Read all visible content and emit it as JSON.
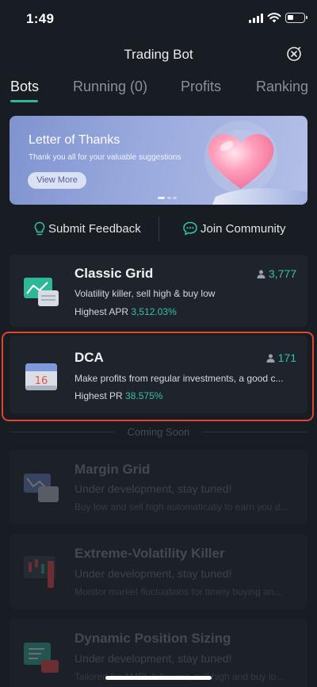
{
  "status_bar": {
    "time": "1:49"
  },
  "header": {
    "title": "Trading Bot"
  },
  "tabs": [
    {
      "label": "Bots",
      "active": true
    },
    {
      "label": "Running (0)",
      "active": false
    },
    {
      "label": "Profits",
      "active": false
    },
    {
      "label": "Ranking",
      "active": false
    }
  ],
  "banner": {
    "title": "Letter of Thanks",
    "subtitle": "Thank you all for your valuable suggestions",
    "button_label": "View More"
  },
  "links": {
    "feedback_label": "Submit Feedback",
    "community_label": "Join Community"
  },
  "bots": [
    {
      "name": "Classic Grid",
      "users": "3,777",
      "description": "Volatility killer, sell high & buy low",
      "metric_label": "Highest APR",
      "metric_value": "3,512.03%"
    },
    {
      "name": "DCA",
      "users": "171",
      "description": "Make profits from regular investments, a good c...",
      "metric_label": "Highest PR",
      "metric_value": "38.575%",
      "calendar_day": "16"
    }
  ],
  "coming_soon": {
    "label": "Coming Soon",
    "items": [
      {
        "name": "Margin Grid",
        "status": "Under development, stay tuned!",
        "description": "Buy low and sell high automatically to earn you d..."
      },
      {
        "name": "Extreme-Volatility Killer",
        "status": "Under development, stay tuned!",
        "description": "Monitor market fluctuations for timely buying an..."
      },
      {
        "name": "Dynamic Position Sizing",
        "status": "Under development, stay tuned!",
        "description": "Tailored for AMPL followers, sell high and buy lo..."
      }
    ]
  },
  "colors": {
    "accent": "#36c09f",
    "highlight": "#e2452d",
    "background": "#181c23"
  },
  "icons": [
    "signal-icon",
    "wifi-icon",
    "battery-icon",
    "close-icon",
    "bulb-icon",
    "chat-icon",
    "user-icon",
    "grid-bot-icon",
    "calendar-icon",
    "margin-grid-icon",
    "candles-icon",
    "position-sizing-icon"
  ]
}
